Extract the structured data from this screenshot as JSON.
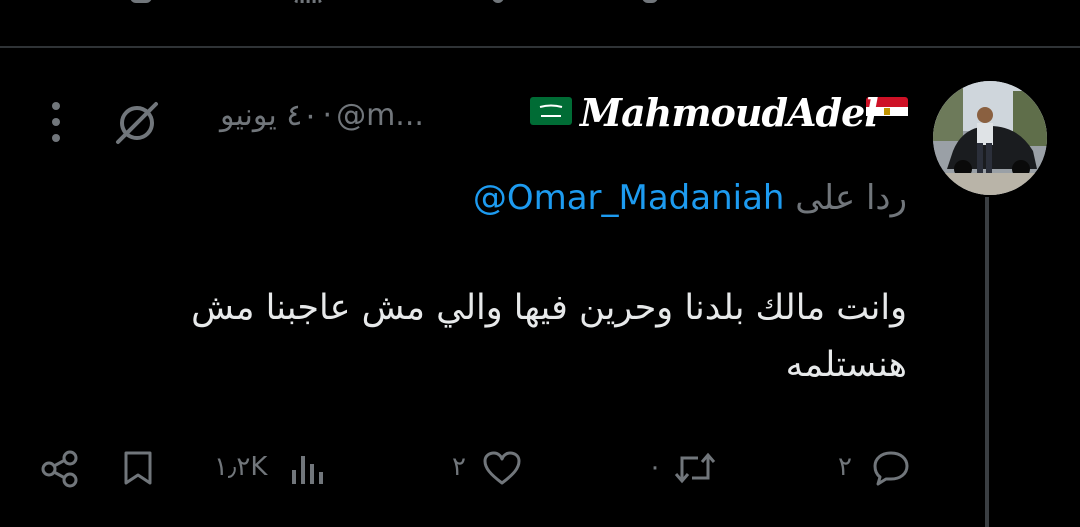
{
  "tweet": {
    "display_name": "MahmoudAdel",
    "handle_truncated": "@m...",
    "separator": "·",
    "date": "٤٠ يونيو",
    "replying_prefix": "ردا على",
    "replying_handle": "@Omar_Madaniah",
    "text": "وانت مالك بلدنا وحرين فيها والي مش عاجبنا مش هنستلمه"
  },
  "actions": {
    "replies": "٢",
    "retweets": "٠",
    "likes": "٢",
    "views": "١٫٢K"
  },
  "icons": {
    "avatar": "avatar",
    "flag_left": "egypt-flag-icon",
    "flag_right": "saudi-flag-icon",
    "grok": "grok-icon",
    "more": "more-vertical-icon",
    "reply": "reply-icon",
    "retweet": "retweet-icon",
    "like": "like-icon",
    "views": "views-icon",
    "bookmark": "bookmark-icon",
    "share": "share-icon"
  },
  "colors": {
    "background": "#000000",
    "text": "#e7e9ea",
    "muted": "#71767b",
    "link": "#1d9bf0",
    "divider": "#2f3336"
  }
}
